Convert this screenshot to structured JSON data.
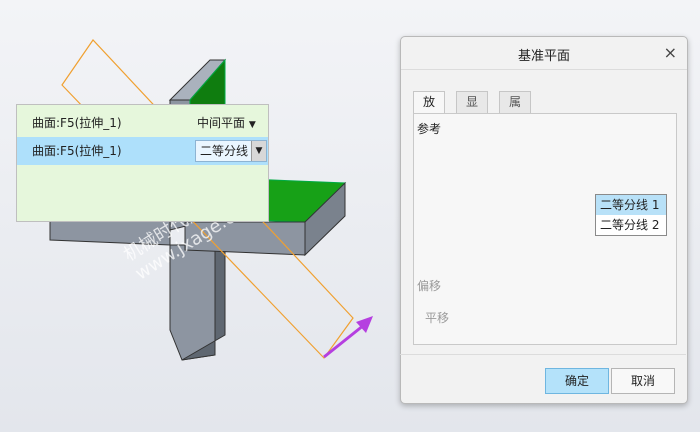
{
  "dialog": {
    "title": "基准平面",
    "tabs": [
      {
        "label": "放置",
        "active": true
      },
      {
        "label": "显示",
        "active": false
      },
      {
        "label": "属性",
        "active": false
      }
    ],
    "references_label": "参考",
    "references": [
      {
        "name": "曲面:F5(拉伸_1)",
        "constraint": "中间平面"
      },
      {
        "name": "曲面:F5(拉伸_1)",
        "constraint": "二等分线"
      }
    ],
    "constraint_options": [
      "二等分线 1",
      "二等分线 2"
    ],
    "offset_label": "偏移",
    "translate_label": "平移",
    "ok_label": "确定",
    "cancel_label": "取消",
    "close_glyph": "×",
    "dropdown_arrow": "▼"
  },
  "watermark": {
    "line1": "机械时代网",
    "line2": "www.jxage.com"
  },
  "colors": {
    "accent_green": "#17a117",
    "model_gray": "#8d95a1",
    "plane_outline": "#f0a030",
    "arrow": "#b53fe0",
    "list_bg": "#e6f7dc",
    "selection": "#aee0fb"
  },
  "icons": {
    "close": "close-icon",
    "dropdown": "chevron-down-icon",
    "direction": "arrow-icon"
  }
}
